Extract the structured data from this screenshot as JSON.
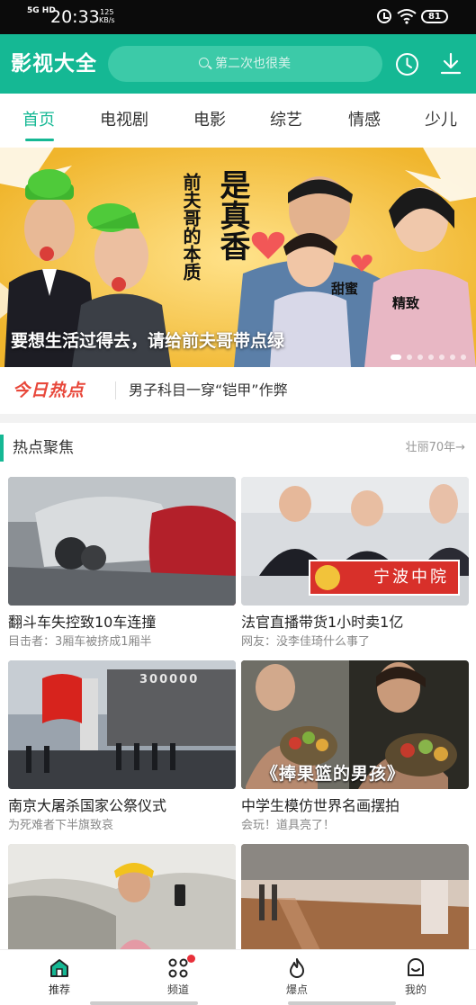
{
  "status_bar": {
    "network": "5G HD",
    "time": "20:33",
    "speed_value": "125",
    "speed_unit": "KB/s",
    "battery": "81"
  },
  "app": {
    "title": "影视大全",
    "search_placeholder": "第二次也很美"
  },
  "tabs": [
    {
      "label": "首页",
      "active": true
    },
    {
      "label": "电视剧"
    },
    {
      "label": "电影"
    },
    {
      "label": "综艺"
    },
    {
      "label": "情感"
    },
    {
      "label": "少儿"
    }
  ],
  "banner": {
    "caption": "要想生活过得去，请给前夫哥带点绿",
    "poster_line1": "前夫哥的本质",
    "poster_big": "是真香",
    "tag_sweet": "甜蜜",
    "tag_fine": "精致"
  },
  "hot_today": {
    "label": "今日热点",
    "headline": "男子科目一穿“铠甲”作弊"
  },
  "section": {
    "title": "热点聚焦",
    "more": "壮丽70年→"
  },
  "cards": [
    {
      "title": "翻斗车失控致10车连撞",
      "subtitle": "目击者：3厢车被挤成1厢半"
    },
    {
      "title": "法官直播带货1小时卖1亿",
      "subtitle": "网友：没李佳琦什么事了",
      "overlay": "宁波中院"
    },
    {
      "title": "南京大屠杀国家公祭仪式",
      "subtitle": "为死难者下半旗致哀",
      "overlay": "300000"
    },
    {
      "title": "中学生模仿世界名画摆拍",
      "subtitle": "会玩！道具亮了！",
      "overlay": "《捧果篮的男孩》"
    },
    {
      "title": "",
      "subtitle": ""
    },
    {
      "title": "",
      "subtitle": ""
    }
  ],
  "bottom_nav": [
    {
      "label": "推荐",
      "icon": "home-icon",
      "active": true
    },
    {
      "label": "频道",
      "icon": "channels-icon",
      "badge": true
    },
    {
      "label": "爆点",
      "icon": "fire-icon"
    },
    {
      "label": "我的",
      "icon": "profile-icon"
    }
  ],
  "colors": {
    "brand": "#15b894",
    "search_bg": "#3ccaa8",
    "hot": "#e8473a",
    "badge": "#e8303a"
  }
}
